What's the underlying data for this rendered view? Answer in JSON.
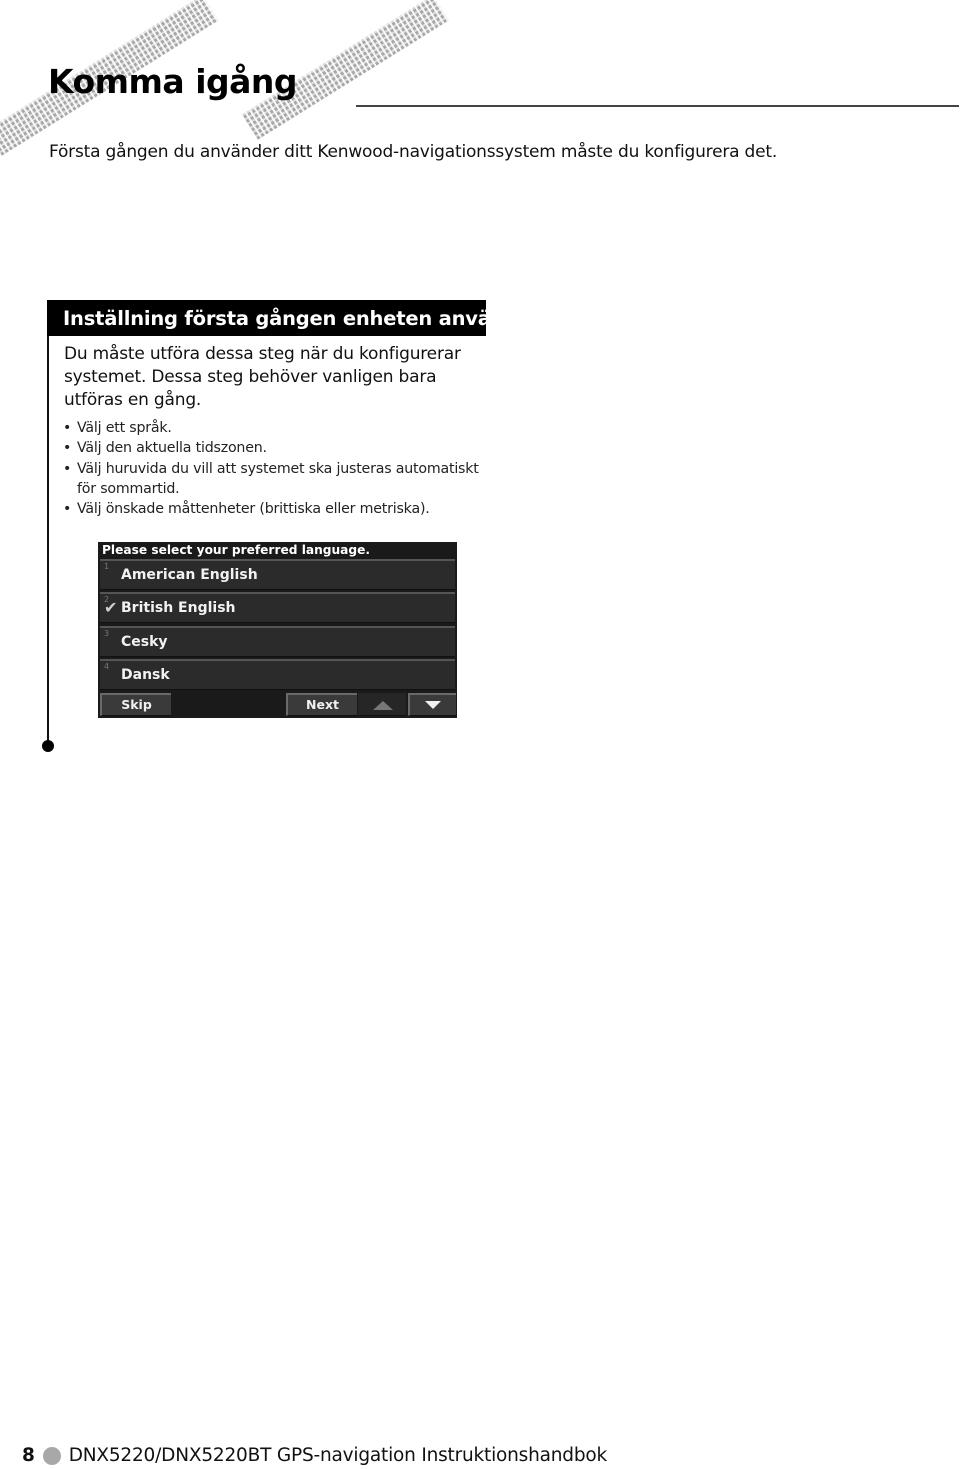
{
  "header": {
    "title": "Komma igång",
    "intro": "Första gången du använder ditt Kenwood-navigationssystem måste du konfigurera det."
  },
  "section": {
    "heading": "Inställning första gången enheten används",
    "lead": "Du måste utföra dessa steg när du konfigurerar systemet. Dessa steg behöver vanligen bara utföras en gång.",
    "bullet_glyph": "•",
    "bullets": [
      "Välj ett språk.",
      "Välj den aktuella tidszonen.",
      "Välj huruvida du vill att systemet ska justeras automatiskt för sommartid.",
      "Välj önskade måttenheter (brittiska eller metriska)."
    ]
  },
  "device_screen": {
    "prompt": "Please select your preferred language.",
    "languages": [
      {
        "number": "1",
        "label": "American English",
        "selected": false
      },
      {
        "number": "2",
        "label": "British English",
        "selected": true
      },
      {
        "number": "3",
        "label": "Cesky",
        "selected": false
      },
      {
        "number": "4",
        "label": "Dansk",
        "selected": false
      }
    ],
    "check_glyph": "✔",
    "buttons": {
      "skip": "Skip",
      "next": "Next",
      "up_icon": "arrow-up",
      "down_icon": "arrow-down"
    }
  },
  "footer": {
    "page_number": "8",
    "document_title": "DNX5220/DNX5220BT GPS-navigation Instruktionshandbok"
  }
}
